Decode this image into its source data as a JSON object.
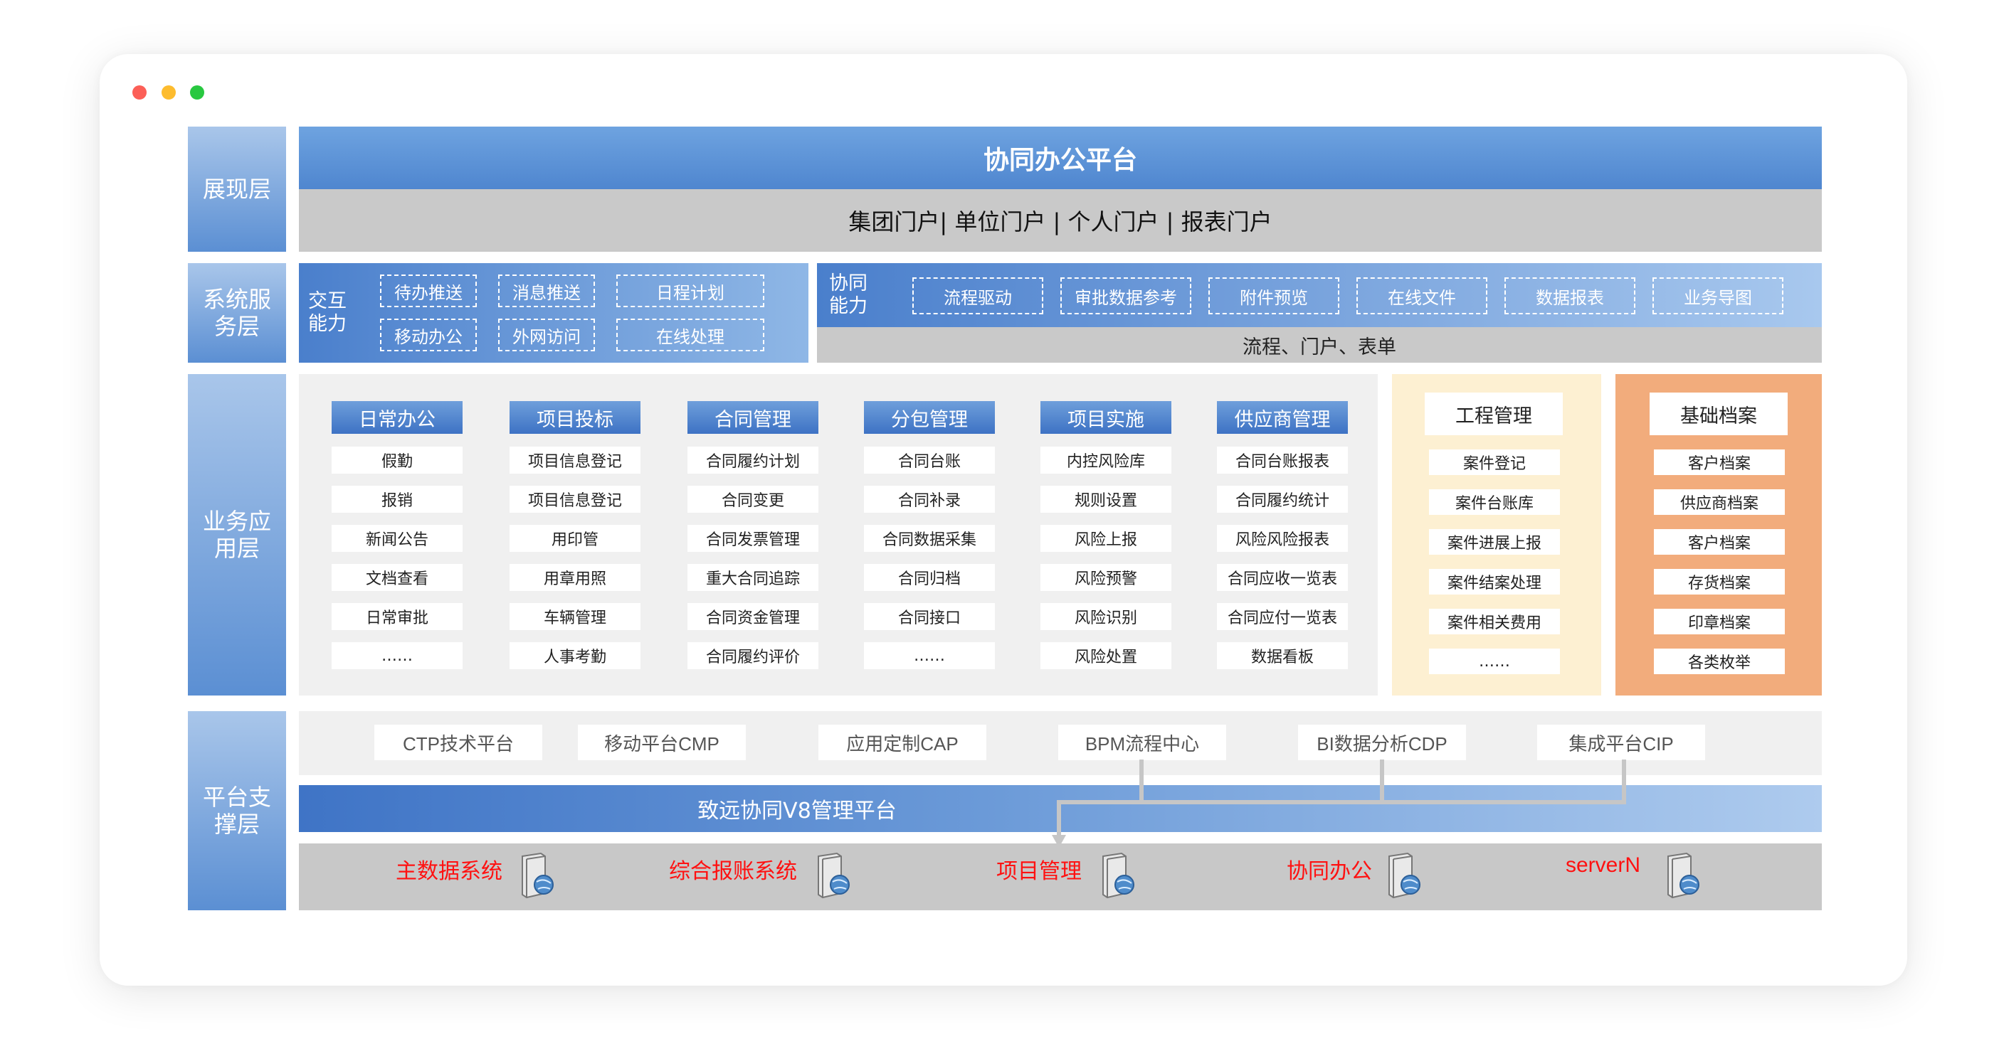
{
  "layers": {
    "presentation": "展现层",
    "service": "系统服务层",
    "business": "业务应用层",
    "platform": "平台支撑层"
  },
  "presentation": {
    "title": "协同办公平台",
    "portals": "集团门户| 单位门户 | 个人门户 | 报表门户"
  },
  "interaction": {
    "label": "交互能力",
    "items": [
      "待办推送",
      "消息推送",
      "日程计划",
      "移动办公",
      "外网访问",
      "在线处理"
    ]
  },
  "collaboration": {
    "label": "协同能力",
    "items": [
      "流程驱动",
      "审批数据参考",
      "附件预览",
      "在线文件",
      "数据报表",
      "业务导图"
    ],
    "footer": "流程、门户、表单"
  },
  "modules": [
    {
      "title": "日常办公",
      "items": [
        "假勤",
        "报销",
        "新闻公告",
        "文档查看",
        "日常审批",
        "……"
      ]
    },
    {
      "title": "项目投标",
      "items": [
        "项目信息登记",
        "项目信息登记",
        "用印管",
        "用章用照",
        "车辆管理",
        "人事考勤"
      ]
    },
    {
      "title": "合同管理",
      "items": [
        "合同履约计划",
        "合同变更",
        "合同发票管理",
        "重大合同追踪",
        "合同资金管理",
        "合同履约评价"
      ]
    },
    {
      "title": "分包管理",
      "items": [
        "合同台账",
        "合同补录",
        "合同数据采集",
        "合同归档",
        "合同接口",
        "……"
      ]
    },
    {
      "title": "项目实施",
      "items": [
        "内控风险库",
        "规则设置",
        "风险上报",
        "风险预警",
        "风险识别",
        "风险处置"
      ]
    },
    {
      "title": "供应商管理",
      "items": [
        "合同台账报表",
        "合同履约统计",
        "风险风险报表",
        "合同应收一览表",
        "合同应付一览表",
        "数据看板"
      ]
    }
  ],
  "engineering": {
    "title": "工程管理",
    "items": [
      "案件登记",
      "案件台账库",
      "案件进展上报",
      "案件结案处理",
      "案件相关费用",
      "……"
    ]
  },
  "archives": {
    "title": "基础档案",
    "items": [
      "客户档案",
      "供应商档案",
      "客户档案",
      "存货档案",
      "印章档案",
      "各类枚举"
    ]
  },
  "platforms": [
    "CTP技术平台",
    "移动平台CMP",
    "应用定制CAP",
    "BPM流程中心",
    "BI数据分析CDP",
    "集成平台CIP"
  ],
  "v8_platform": "致远协同V8管理平台",
  "systems": [
    "主数据系统",
    "综合报账系统",
    "项目管理",
    "协同办公",
    "serverN"
  ],
  "colors": {
    "accent_blue": "#5b93d8",
    "gray_band": "#c8c8c8",
    "system_text": "#ff1111",
    "engineering_bg": "#fdf0d2",
    "archives_bg": "#f2ac7c"
  }
}
